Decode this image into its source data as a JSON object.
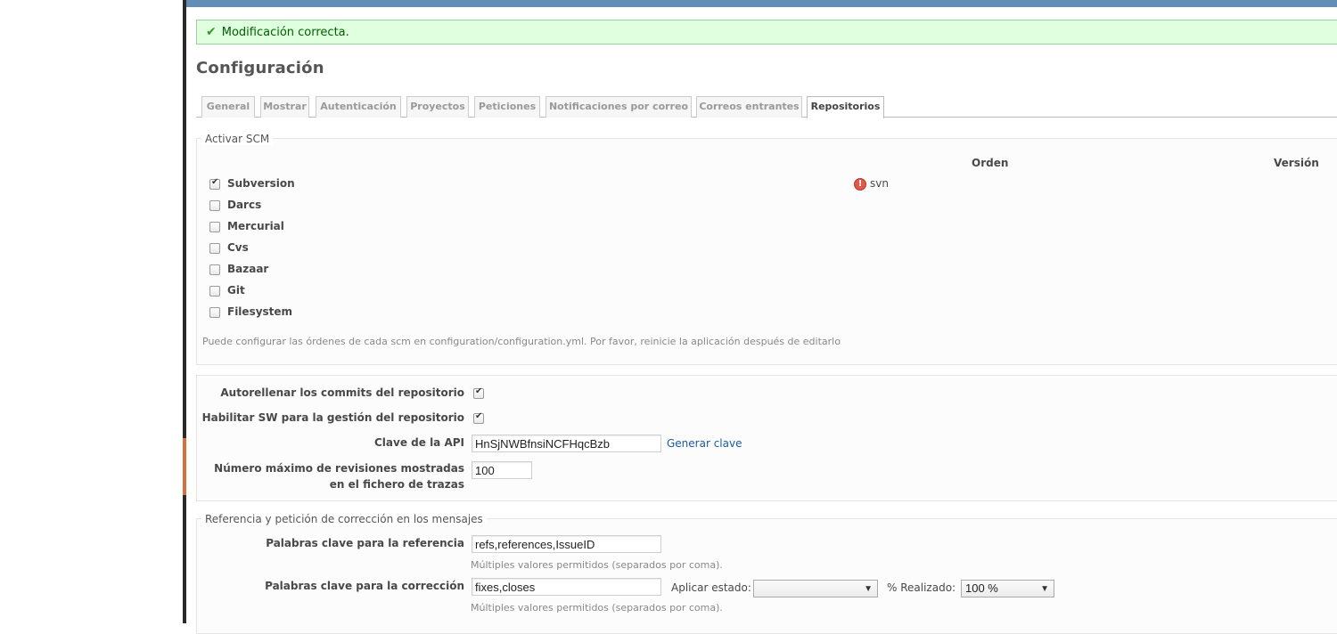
{
  "flash": {
    "message": "Modificación correcta."
  },
  "page": {
    "title": "Configuración"
  },
  "tabs": [
    {
      "label": "General"
    },
    {
      "label": "Mostrar"
    },
    {
      "label": "Autenticación"
    },
    {
      "label": "Proyectos"
    },
    {
      "label": "Peticiones"
    },
    {
      "label": "Notificaciones por correo"
    },
    {
      "label": "Correos entrantes"
    },
    {
      "label": "Repositorios",
      "selected": true
    }
  ],
  "scm": {
    "legend": "Activar SCM",
    "col_order": "Orden",
    "col_version": "Versión",
    "items": [
      {
        "name": "Subversion",
        "checked": true,
        "command": "svn",
        "warning": true
      },
      {
        "name": "Darcs",
        "checked": false
      },
      {
        "name": "Mercurial",
        "checked": false
      },
      {
        "name": "Cvs",
        "checked": false
      },
      {
        "name": "Bazaar",
        "checked": false
      },
      {
        "name": "Git",
        "checked": false
      },
      {
        "name": "Filesystem",
        "checked": false
      }
    ],
    "hint": "Puede configurar las órdenes de cada scm en configuration/configuration.yml. Por favor, reinicie la aplicación después de editarlo"
  },
  "settings": {
    "autofetch_label": "Autorellenar los commits del repositorio",
    "autofetch_checked": true,
    "ws_label": "Habilitar SW para la gestión del repositorio",
    "ws_checked": true,
    "api_key_label": "Clave de la API",
    "api_key_value": "HnSjNWBfnsiNCFHqcBzb",
    "generate_key": "Generar clave",
    "max_revisions_label_1": "Número máximo de revisiones mostradas",
    "max_revisions_label_2": "en el fichero de trazas",
    "max_revisions_value": "100"
  },
  "references": {
    "legend": "Referencia y petición de corrección en los mensajes",
    "ref_keywords_label": "Palabras clave para la referencia",
    "ref_keywords_value": "refs,references,IssueID",
    "ref_hint": "Múltiples valores permitidos (separados por coma).",
    "fix_keywords_label": "Palabras clave para la corrección",
    "fix_keywords_value": "fixes,closes",
    "fix_hint": "Múltiples valores permitidos (separados por coma).",
    "apply_status_label": "Aplicar estado:",
    "apply_status_value": "",
    "done_ratio_label": "% Realizado:",
    "done_ratio_value": "100 %"
  },
  "colors": {
    "top_bar": "#628db6",
    "flash_bg": "#dfffdf",
    "link": "#1a5a9e",
    "warning": "#e05a4a"
  }
}
